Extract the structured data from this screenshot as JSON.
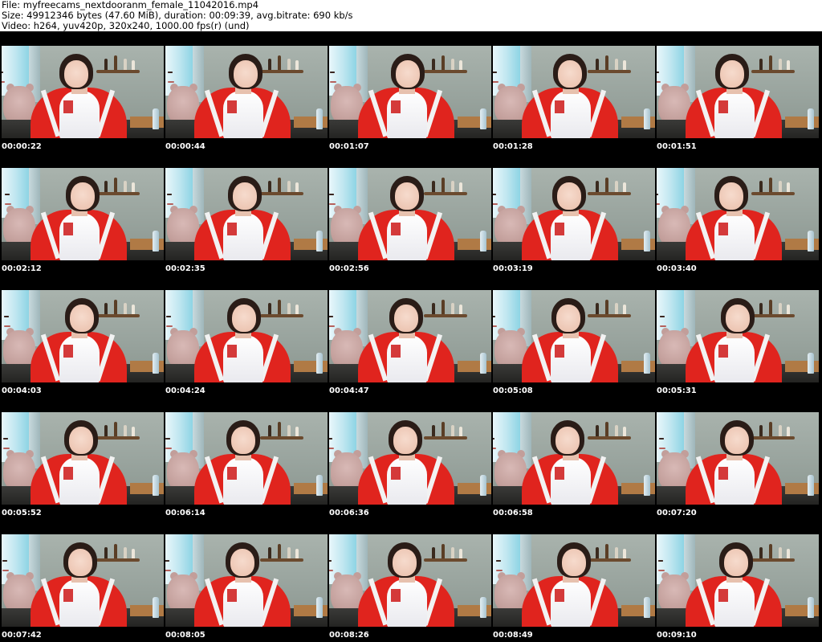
{
  "header": {
    "file_line": "File: myfreecams_nextdooranm_female_11042016.mp4",
    "size_line": "Size: 49912346 bytes (47.60 MiB), duration: 00:09:39, avg.bitrate: 690 kb/s",
    "video_line": "Video: h264, yuv420p, 320x240, 1000.00 fps(r) (und)"
  },
  "thumbnails": [
    {
      "timestamp": "00:00:22"
    },
    {
      "timestamp": "00:00:44"
    },
    {
      "timestamp": "00:01:07"
    },
    {
      "timestamp": "00:01:28"
    },
    {
      "timestamp": "00:01:51"
    },
    {
      "timestamp": "00:02:12"
    },
    {
      "timestamp": "00:02:35"
    },
    {
      "timestamp": "00:02:56"
    },
    {
      "timestamp": "00:03:19"
    },
    {
      "timestamp": "00:03:40"
    },
    {
      "timestamp": "00:04:03"
    },
    {
      "timestamp": "00:04:24"
    },
    {
      "timestamp": "00:04:47"
    },
    {
      "timestamp": "00:05:08"
    },
    {
      "timestamp": "00:05:31"
    },
    {
      "timestamp": "00:05:52"
    },
    {
      "timestamp": "00:06:14"
    },
    {
      "timestamp": "00:06:36"
    },
    {
      "timestamp": "00:06:58"
    },
    {
      "timestamp": "00:07:20"
    },
    {
      "timestamp": "00:07:42"
    },
    {
      "timestamp": "00:08:05"
    },
    {
      "timestamp": "00:08:26"
    },
    {
      "timestamp": "00:08:49"
    },
    {
      "timestamp": "00:09:10"
    }
  ],
  "colors": {
    "sheet_background": "#000000",
    "timestamp_text": "#ffffff",
    "jacket": "#e0241e"
  }
}
